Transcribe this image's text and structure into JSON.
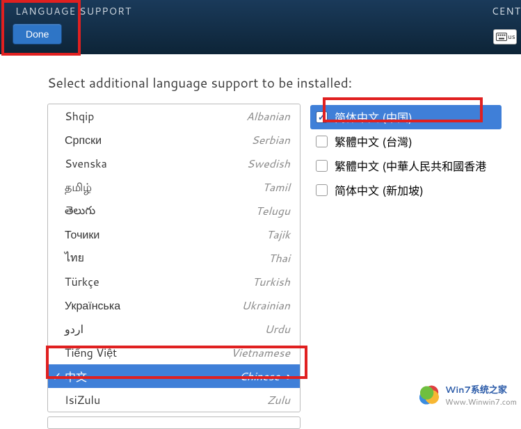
{
  "header": {
    "title": "LANGUAGE SUPPORT",
    "right_label": "CENT",
    "done_label": "Done",
    "kbd_label": "us"
  },
  "prompt": "Select additional language support to be installed:",
  "languages": [
    {
      "native": "Shqip",
      "english": "Albanian",
      "selected": false
    },
    {
      "native": "Српски",
      "english": "Serbian",
      "selected": false
    },
    {
      "native": "Svenska",
      "english": "Swedish",
      "selected": false
    },
    {
      "native": "தமிழ்",
      "english": "Tamil",
      "selected": false
    },
    {
      "native": "తెలుగు",
      "english": "Telugu",
      "selected": false
    },
    {
      "native": "Точики",
      "english": "Tajik",
      "selected": false
    },
    {
      "native": "ไทย",
      "english": "Thai",
      "selected": false
    },
    {
      "native": "Türkçe",
      "english": "Turkish",
      "selected": false
    },
    {
      "native": "Українська",
      "english": "Ukrainian",
      "selected": false
    },
    {
      "native": "اردو",
      "english": "Urdu",
      "selected": false
    },
    {
      "native": "Tiếng Việt",
      "english": "Vietnamese",
      "selected": false
    },
    {
      "native": "中文",
      "english": "Chinese",
      "selected": true
    },
    {
      "native": "IsiZulu",
      "english": "Zulu",
      "selected": false
    }
  ],
  "locales": [
    {
      "label": "简体中文 (中国)",
      "checked": true,
      "selected": true
    },
    {
      "label": "繁體中文 (台灣)",
      "checked": false,
      "selected": false
    },
    {
      "label": "繁體中文 (中華人民共和國香港",
      "checked": false,
      "selected": false
    },
    {
      "label": "简体中文 (新加坡)",
      "checked": false,
      "selected": false
    }
  ],
  "watermark": {
    "line1": "Win7系统之家",
    "line2": "Www.Winwin7.com"
  }
}
